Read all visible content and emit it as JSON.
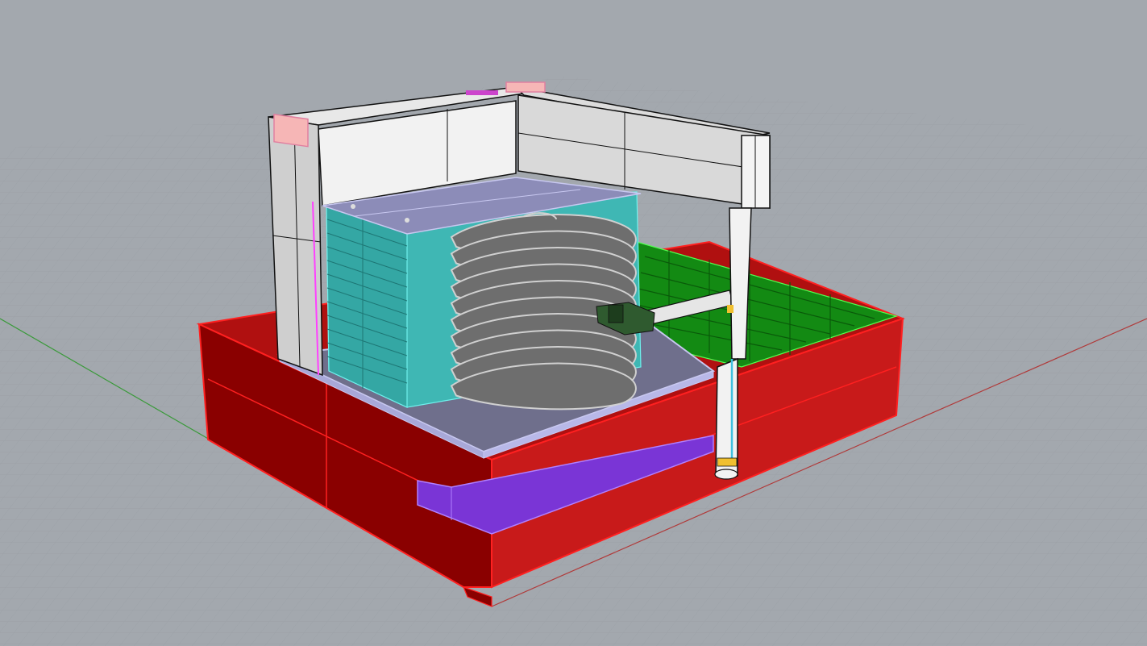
{
  "viewport": {
    "view": "perspective",
    "background_color": "#a3a8ae",
    "grid": true,
    "grid_minor_color": "#9aa0a6",
    "grid_major_color": "#8a9096",
    "x_axis_color": "#b03a3a",
    "y_axis_color": "#3a9a3a"
  },
  "model": {
    "colors": {
      "base": "#c81a1a",
      "base_dark": "#8a0000",
      "base_edge": "#ff2020",
      "track": "#7a35d6",
      "tray_green": "#138a13",
      "plate": "#6f6f8c",
      "plate_edge": "#c8c8f0",
      "rack": "#43c4c0",
      "wafer": "#6e6e6e",
      "wafer_edge": "#d0d0d0",
      "frame": "#f2f2f2",
      "frame_side": "#c9c9c9",
      "corner_pad": "#f6b6b6",
      "arm": "#2f5a2f",
      "highlight": "#ff40ff"
    },
    "wafer_count": 10,
    "rack_slots": 13
  }
}
